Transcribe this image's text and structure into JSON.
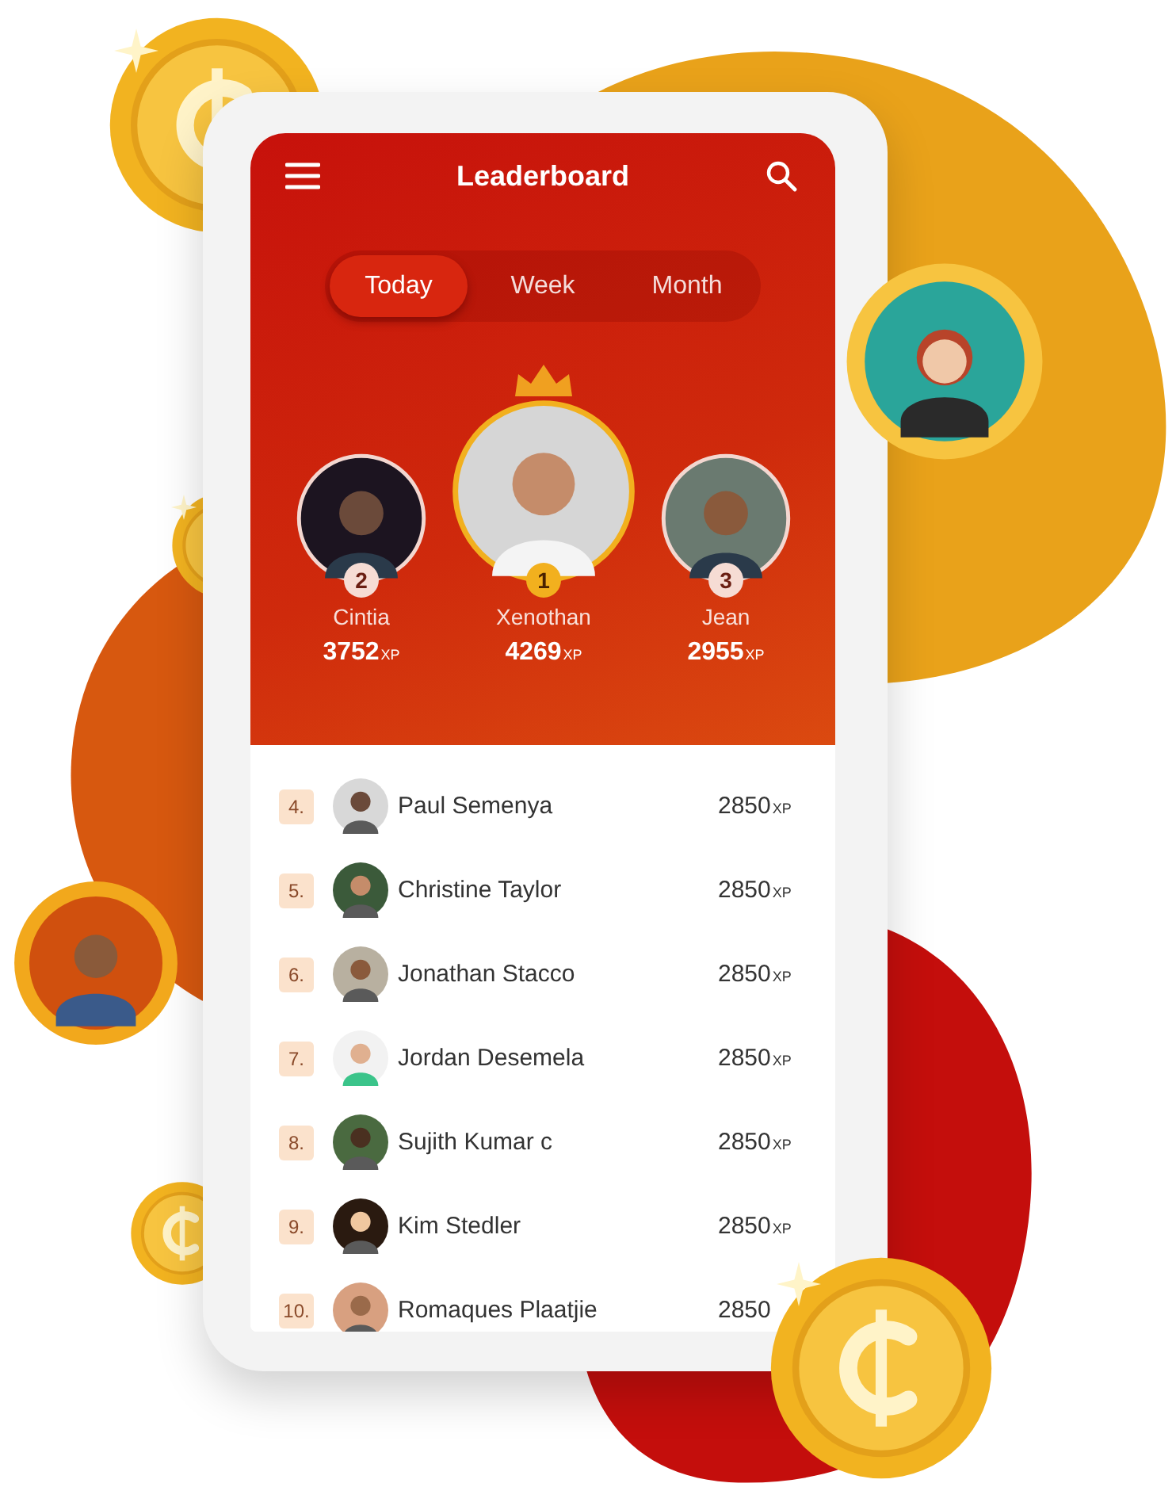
{
  "app_bar": {
    "title": "Leaderboard"
  },
  "tabs": [
    {
      "label": "Today",
      "selected": true
    },
    {
      "label": "Week",
      "selected": false
    },
    {
      "label": "Month",
      "selected": false
    }
  ],
  "podium": [
    {
      "rank": "2",
      "name": "Cintia",
      "score": "3752",
      "unit": "XP",
      "crowned": false
    },
    {
      "rank": "1",
      "name": "Xenothan",
      "score": "4269",
      "unit": "XP",
      "crowned": true
    },
    {
      "rank": "3",
      "name": "Jean",
      "score": "2955",
      "unit": "XP",
      "crowned": false
    }
  ],
  "rows": [
    {
      "rank": "4.",
      "name": "Paul Semenya",
      "score": "2850",
      "unit": "XP"
    },
    {
      "rank": "5.",
      "name": "Christine Taylor",
      "score": "2850",
      "unit": "XP"
    },
    {
      "rank": "6.",
      "name": "Jonathan Stacco",
      "score": "2850",
      "unit": "XP"
    },
    {
      "rank": "7.",
      "name": "Jordan Desemela",
      "score": "2850",
      "unit": "XP"
    },
    {
      "rank": "8.",
      "name": "Sujith Kumar c",
      "score": "2850",
      "unit": "XP"
    },
    {
      "rank": "9.",
      "name": "Kim Stedler",
      "score": "2850",
      "unit": "XP"
    },
    {
      "rank": "10.",
      "name": "Romaques Plaatjie",
      "score": "2850"
    }
  ]
}
